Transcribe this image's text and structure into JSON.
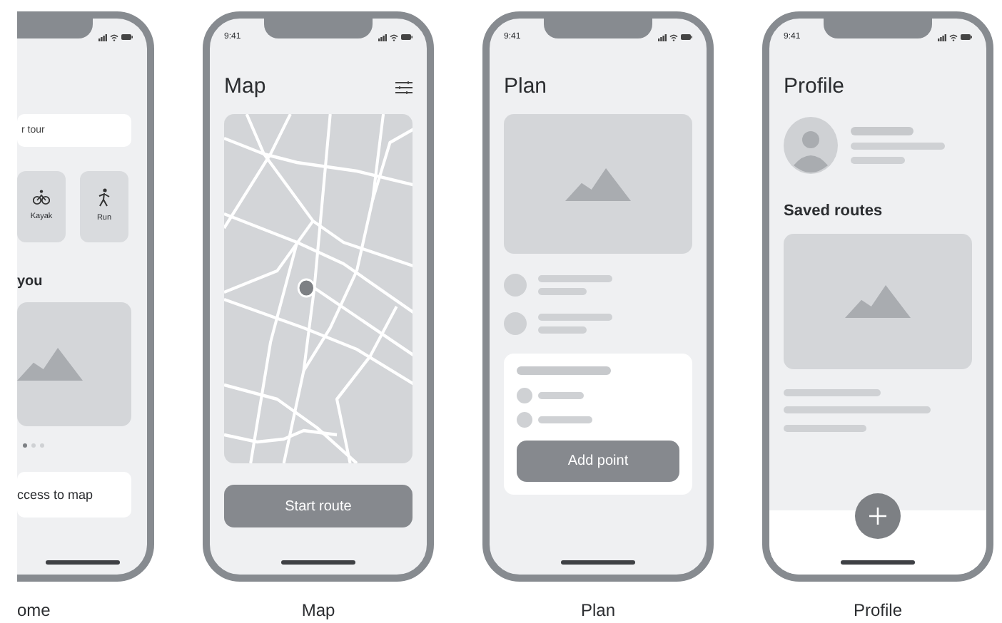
{
  "screens": [
    {
      "kind": "home",
      "caption": "ome",
      "search": {
        "placeholder": "r tour"
      },
      "categories": [
        {
          "kind": "bike",
          "label": "Kayak"
        },
        {
          "kind": "run",
          "label": "Run"
        }
      ],
      "section_title": "you",
      "carousel_dots": [
        {
          "selected": true
        },
        {
          "selected": false
        },
        {
          "selected": false
        }
      ],
      "link_card": "ccess to map"
    },
    {
      "kind": "map",
      "time": "9:41",
      "title": "Map",
      "button": "Start route",
      "caption": "Map"
    },
    {
      "kind": "plan",
      "time": "9:41",
      "title": "Plan",
      "button": "Add point",
      "caption": "Plan"
    },
    {
      "kind": "profile",
      "time": "9:41",
      "title": "Profile",
      "section_title": "Saved routes",
      "caption": "Profile"
    }
  ]
}
